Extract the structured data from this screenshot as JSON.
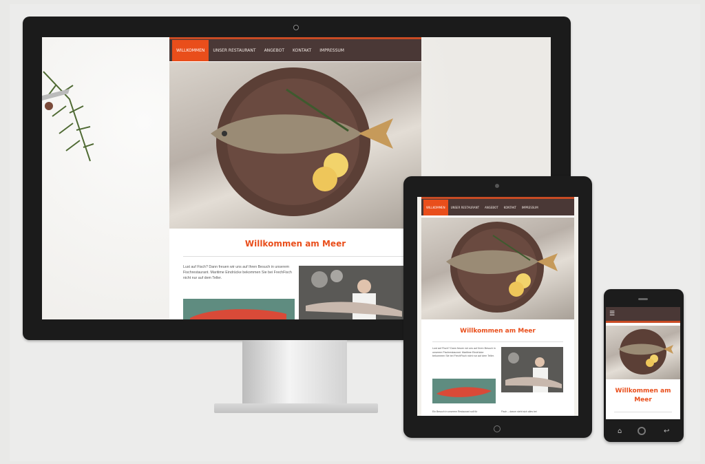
{
  "site": {
    "nav": [
      "Willkommen",
      "Unser Restaurant",
      "Angebot",
      "Kontakt",
      "Impressum"
    ],
    "active_nav_index": 0,
    "heading": "Willkommen am Meer",
    "intro": "Lust auf Fisch? Dann freuen wir uns auf Ihren Besuch in unserem Fischrestaurant. Maritime Eindrücke bekommen Sie bei FrechFisch nicht nur auf dem Teller.",
    "intro_tablet": "Lust auf Fisch? Dann freuen wir uns auf Ihren Besuch in unserem Fischrestaurant. Maritime Eindrücke bekommen Sie bei FrechFisch nicht nur auf dem Teller.",
    "footer_text_left": "Ein Besuch in unserem Restaurant soll für",
    "footer_text_right": "Fisch – darum steht sich alles bei",
    "menu_icon": "hamburger-menu-icon"
  },
  "colors": {
    "accent": "#e94e1b",
    "nav_bg": "#4a3836"
  },
  "phone_buttons": {
    "home": "home-icon",
    "center": "camera-button-icon",
    "back": "back-icon"
  }
}
